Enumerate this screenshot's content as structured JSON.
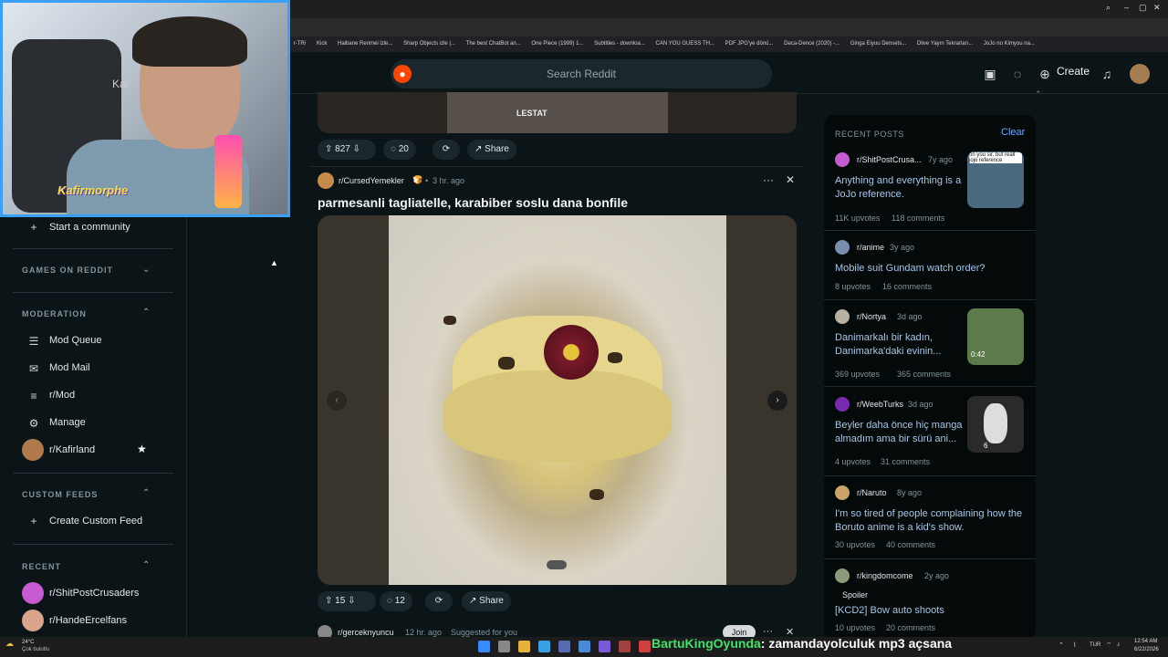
{
  "bookmarks": [
    "r-TR/",
    "Kick",
    "Haibane Renmei izle...",
    "Sharp Objects izle |...",
    "The best ChatBot an...",
    "One Piece (1999) 1...",
    "Subtitles - downloa...",
    "CAN YOU GUESS TH...",
    "PDF JPG'ye dönü...",
    "Deca-Dence (2020) -...",
    "Ginga Eiyuu Densets...",
    "Dlive Yayın Tekrarları...",
    "JoJo no Kimyou na..."
  ],
  "header": {
    "search_placeholder": "Search Reddit",
    "create_label": "Create"
  },
  "webcam": {
    "name_overlay": "Kafirmorphe",
    "bg_text": "Kar"
  },
  "sidebar": {
    "start_community": "Start a community",
    "games_heading": "GAMES ON REDDIT",
    "moderation_heading": "MODERATION",
    "mod_items": [
      {
        "label": "Mod Queue",
        "icon": "queue-icon"
      },
      {
        "label": "Mod Mail",
        "icon": "mail-icon"
      },
      {
        "label": "r/Mod",
        "icon": "mod-icon"
      },
      {
        "label": "Manage",
        "icon": "gear-icon"
      }
    ],
    "favorite_sub": "r/Kafirland",
    "custom_feeds_heading": "CUSTOM FEEDS",
    "create_custom_feed": "Create Custom Feed",
    "recent_heading": "RECENT",
    "recent_items": [
      "r/ShitPostCrusaders",
      "r/HandeErcelfans"
    ]
  },
  "feed": {
    "prev_post": {
      "upvotes": "827",
      "comments": "20",
      "share": "Share",
      "image_text": "LESTAT"
    },
    "post": {
      "subreddit": "r/CursedYemekler",
      "time": "3 hr. ago",
      "title": "parmesanli tagliatelle, karabiber soslu dana bonfile",
      "upvotes": "15",
      "comments": "12",
      "share": "Share"
    },
    "next_post": {
      "subreddit": "r/gerceknyuncu",
      "time": "12 hr. ago",
      "suggested": "Suggested for you",
      "join": "Join"
    }
  },
  "recent_posts": {
    "heading": "RECENT POSTS",
    "clear_label": "Clear",
    "items": [
      {
        "sub": "r/ShitPostCrusa...",
        "time": "7y ago",
        "title": "Anything and everything is a JoJo reference.",
        "upvotes": "11K upvotes",
        "comments": "118 comments",
        "thumb_caption": "on you sir, but reall jojo reference",
        "thumb_color": "#4a6a80",
        "av_color": "#c75bd1"
      },
      {
        "sub": "r/anime",
        "time": "3y ago",
        "title": "Mobile suit Gundam watch order?",
        "upvotes": "8 upvotes",
        "comments": "16 comments",
        "av_color": "#7a8fb0"
      },
      {
        "sub": "r/Nortya",
        "time": "3d ago",
        "title": "Danimarkalı bir kadın, Danimarka'daki evinin...",
        "upvotes": "369 upvotes",
        "comments": "365 comments",
        "thumb_caption": "0:42",
        "thumb_color": "#5c7a4a",
        "av_color": "#b8b0a0"
      },
      {
        "sub": "r/WeebTurks",
        "time": "3d ago",
        "title": "Beyler daha önce hiç manga almadım ama bir sürü ani...",
        "upvotes": "4 upvotes",
        "comments": "31 comments",
        "thumb_caption": "6",
        "thumb_color": "#2a2a2a",
        "av_color": "#7a2ab0"
      },
      {
        "sub": "r/Naruto",
        "time": "8y ago",
        "title": "I'm so tired of people complaining how the Boruto anime is a kid's show.",
        "upvotes": "30 upvotes",
        "comments": "40 comments",
        "av_color": "#c9a36a"
      },
      {
        "sub": "r/kingdomcome",
        "time": "2y ago",
        "spoiler": "Spoiler",
        "title": "[KCD2] Bow auto shoots",
        "upvotes": "10 upvotes",
        "comments": "20 comments",
        "av_color": "#8a9a7a"
      }
    ]
  },
  "taskbar": {
    "weather_temp": "24°C",
    "weather_desc": "Çok bulutlu",
    "lang": "TUR",
    "time": "12:54 AM",
    "date": "6/22/2026"
  },
  "chat": {
    "user": "BartuKingOyunda",
    "message": ": zamandayolculuk mp3 açsana"
  }
}
